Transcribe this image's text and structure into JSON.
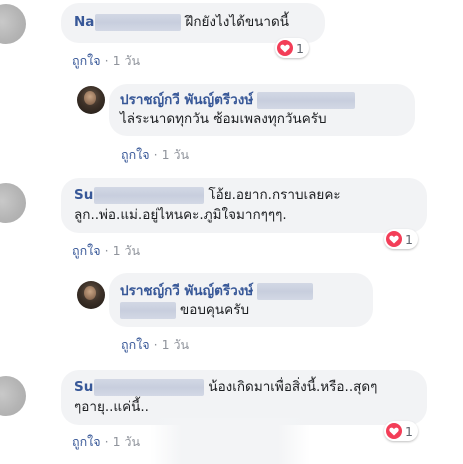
{
  "comments": [
    {
      "author": "Na",
      "text": "ฝึกยังไงได้ขนาดนี้",
      "like_label": "ถูกใจ",
      "separator": "·",
      "time": "1 วัน",
      "reaction_count": "1"
    },
    {
      "author": "ปราชญ์กวี พันญ์ตรีวงษ์",
      "text": "ไล่ระนาดทุกวัน ซ้อมเพลงทุกวันครับ",
      "like_label": "ถูกใจ",
      "separator": "·",
      "time": "1 วัน"
    },
    {
      "author": "Su",
      "text_line1": "โอ้ย.อยาก.กราบเลยคะ",
      "text_line2": "ลูก..พ่อ.แม่.อยู่ไหนคะ.ภูมิใจมากๆๆๆ.",
      "like_label": "ถูกใจ",
      "separator": "·",
      "time": "1 วัน",
      "reaction_count": "1"
    },
    {
      "author": "ปราชญ์กวี พันญ์ตรีวงษ์",
      "text": "ขอบคุนครับ",
      "like_label": "ถูกใจ",
      "separator": "·",
      "time": "1 วัน"
    },
    {
      "author": "Su",
      "text_line1": "น้องเกิดมาเพื่อสิ่งนี้.หรือ..สุดๆ",
      "text_line2": "ๆอายุ..แค่นี้..",
      "like_label": "ถูกใจ",
      "separator": "·",
      "time": "1 วัน",
      "reaction_count": "1"
    }
  ],
  "colors": {
    "bubble": "#f2f3f5",
    "author": "#385898",
    "meta": "#385898",
    "time": "#90949c",
    "heart": "#f33e58"
  },
  "icons": {
    "reaction": "heart-icon"
  }
}
